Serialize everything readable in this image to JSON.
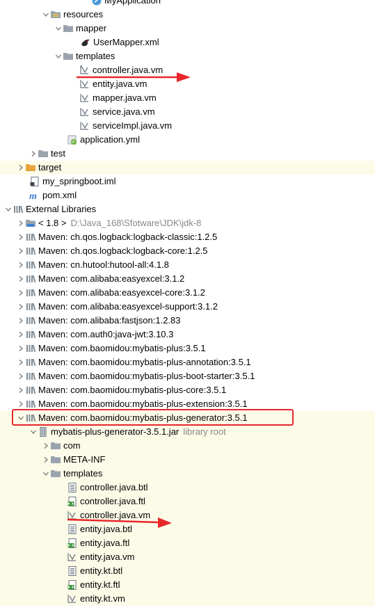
{
  "tree": {
    "myapplication": "MyApplication",
    "resources": "resources",
    "mapper": "mapper",
    "usermapper": "UserMapper.xml",
    "templates": "templates",
    "controller_vm": "controller.java.vm",
    "entity_vm": "entity.java.vm",
    "mapper_vm": "mapper.java.vm",
    "service_vm": "service.java.vm",
    "serviceimpl_vm": "serviceImpl.java.vm",
    "application_yml": "application.yml",
    "test": "test",
    "target": "target",
    "iml": "my_springboot.iml",
    "pom": "pom.xml",
    "external_libraries": "External Libraries",
    "jdk": "< 1.8 >",
    "jdk_path": "D:\\Java_168\\Sfotware\\JDK\\jdk-8",
    "libs": [
      "Maven: ch.qos.logback:logback-classic:1.2.5",
      "Maven: ch.qos.logback:logback-core:1.2.5",
      "Maven: cn.hutool:hutool-all:4.1.8",
      "Maven: com.alibaba:easyexcel:3.1.2",
      "Maven: com.alibaba:easyexcel-core:3.1.2",
      "Maven: com.alibaba:easyexcel-support:3.1.2",
      "Maven: com.alibaba:fastjson:1.2.83",
      "Maven: com.auth0:java-jwt:3.10.3",
      "Maven: com.baomidou:mybatis-plus:3.5.1",
      "Maven: com.baomidou:mybatis-plus-annotation:3.5.1",
      "Maven: com.baomidou:mybatis-plus-boot-starter:3.5.1",
      "Maven: com.baomidou:mybatis-plus-core:3.5.1",
      "Maven: com.baomidou:mybatis-plus-extension:3.5.1",
      "Maven: com.baomidou:mybatis-plus-generator:3.5.1"
    ],
    "jar": "mybatis-plus-generator-3.5.1.jar",
    "jar_note": "library root",
    "com": "com",
    "metainf": "META-INF",
    "templates2": "templates",
    "tpl_files": [
      "controller.java.btl",
      "controller.java.ftl",
      "controller.java.vm",
      "entity.java.btl",
      "entity.java.ftl",
      "entity.java.vm",
      "entity.kt.btl",
      "entity.kt.ftl",
      "entity.kt.vm"
    ]
  },
  "colors": {
    "highlight_row": "#fbfbe8",
    "annotation_red": "#e8262a",
    "folder_gray": "#9aa3ad",
    "folder_orange": "#e8a33d",
    "library_bars": "#7f8b95"
  }
}
